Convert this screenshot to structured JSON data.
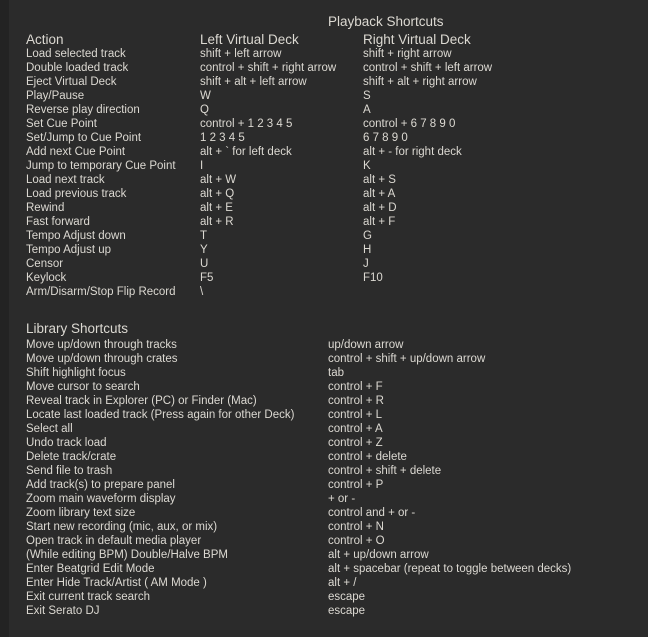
{
  "theme": {
    "background": "#2b2b2b",
    "edge": "#232323",
    "text": "#dcd9d2"
  },
  "playback": {
    "title": "Playback Shortcuts",
    "headers": {
      "action": "Action",
      "left": "Left Virtual Deck",
      "right": "Right Virtual Deck"
    },
    "rows": [
      {
        "action": "Load selected track",
        "left": "shift + left arrow",
        "right": "shift + right arrow"
      },
      {
        "action": "Double loaded track",
        "left": "control + shift + right arrow",
        "right": "control + shift + left arrow"
      },
      {
        "action": "Eject Virtual Deck",
        "left": "shift + alt + left arrow",
        "right": "shift + alt + right arrow"
      },
      {
        "action": "Play/Pause",
        "left": "W",
        "right": "S"
      },
      {
        "action": "Reverse play direction",
        "left": "Q",
        "right": "A"
      },
      {
        "action": "Set Cue Point",
        "left": "control + 1 2 3 4 5",
        "right": "control + 6 7 8 9 0"
      },
      {
        "action": "Set/Jump to Cue Point",
        "left": "1 2 3 4 5",
        "right": "6 7 8 9 0"
      },
      {
        "action": "Add next Cue Point",
        "left": "alt + ` for left deck",
        "right": "alt + - for right deck"
      },
      {
        "action": "Jump to temporary Cue Point",
        "left": "I",
        "right": "K"
      },
      {
        "action": "Load next track",
        "left": "alt + W",
        "right": "alt + S"
      },
      {
        "action": "Load previous track",
        "left": "alt + Q",
        "right": "alt + A"
      },
      {
        "action": "Rewind",
        "left": "alt + E",
        "right": "alt + D"
      },
      {
        "action": "Fast forward",
        "left": "alt + R",
        "right": "alt + F"
      },
      {
        "action": "Tempo Adjust down",
        "left": "T",
        "right": "G"
      },
      {
        "action": "Tempo Adjust up",
        "left": "Y",
        "right": "H"
      },
      {
        "action": "Censor",
        "left": "U",
        "right": "J"
      },
      {
        "action": "Keylock",
        "left": "F5",
        "right": "F10"
      },
      {
        "action": "Arm/Disarm/Stop Flip Record",
        "left": "\\",
        "right": ""
      }
    ]
  },
  "library": {
    "title": "Library Shortcuts",
    "rows": [
      {
        "action": "Move up/down through tracks",
        "left": "up/down arrow"
      },
      {
        "action": "Move up/down through crates",
        "left": "control + shift + up/down arrow"
      },
      {
        "action": "Shift highlight focus",
        "left": "tab"
      },
      {
        "action": "Move cursor to search",
        "left": "control + F"
      },
      {
        "action": "Reveal track in Explorer (PC) or Finder (Mac)",
        "left": "control + R"
      },
      {
        "action": "Locate last loaded track (Press again for other Deck)",
        "left": "control + L"
      },
      {
        "action": "Select all",
        "left": "control + A"
      },
      {
        "action": "Undo track load",
        "left": "control + Z"
      },
      {
        "action": "Delete track/crate",
        "left": "control + delete"
      },
      {
        "action": "Send file to trash",
        "left": "control + shift + delete"
      },
      {
        "action": "Add track(s) to prepare panel",
        "left": "control + P"
      },
      {
        "action": "Zoom main waveform display",
        "left": "+ or -"
      },
      {
        "action": "Zoom library text size",
        "left": "control and + or -"
      },
      {
        "action": "Start new recording (mic, aux, or mix)",
        "left": "control + N"
      },
      {
        "action": "Open track in default media player",
        "left": "control + O"
      },
      {
        "action": "(While editing BPM) Double/Halve BPM",
        "left": "alt + up/down arrow"
      },
      {
        "action": "Enter Beatgrid Edit Mode",
        "left": "alt + spacebar (repeat to toggle between decks)"
      },
      {
        "action": "Enter Hide Track/Artist ( AM Mode )",
        "left": "alt + /"
      },
      {
        "action": "Exit current track search",
        "left": "escape"
      },
      {
        "action": "Exit Serato DJ",
        "left": "escape"
      }
    ]
  }
}
